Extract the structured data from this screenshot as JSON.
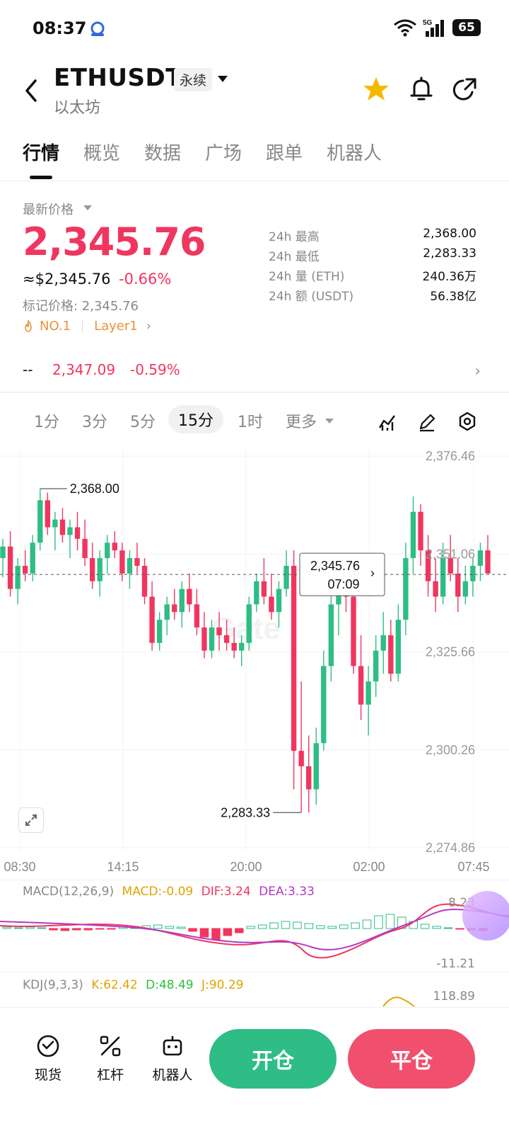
{
  "status_bar": {
    "time": "08:37",
    "network": "5G",
    "battery": "65"
  },
  "header": {
    "pair": "ETHUSDT",
    "contract_type": "永续",
    "subtitle": "以太坊"
  },
  "tabs": [
    "行情",
    "概览",
    "数据",
    "广场",
    "跟单",
    "机器人"
  ],
  "price": {
    "latest_label": "最新价格",
    "last_price": "2,345.76",
    "usd_price": "≈$2,345.76",
    "change_pct": "-0.66%",
    "mark_price": "标记价格: 2,345.76",
    "rank_tag": "NO.1",
    "sector_tag": "Layer1",
    "stats": [
      {
        "label": "24h  最高",
        "value": "2,368.00"
      },
      {
        "label": "24h  最低",
        "value": "2,283.33"
      },
      {
        "label": "24h  量 (ETH)",
        "value": "240.36万"
      },
      {
        "label": "24h  额 (USDT)",
        "value": "56.38亿"
      }
    ],
    "index_dash": "--",
    "index_price": "2,347.09",
    "index_change": "-0.59%"
  },
  "intervals": [
    "1分",
    "3分",
    "5分",
    "15分",
    "1时",
    "更多"
  ],
  "active_interval": "15分",
  "chart_data": {
    "type": "candlestick",
    "y_ticks": [
      "2,376.46",
      "2,351.06",
      "2,325.66",
      "2,300.26",
      "2,274.86"
    ],
    "y_range": [
      2274.86,
      2376.46
    ],
    "x_ticks": [
      "08:30",
      "14:15",
      "20:00",
      "02:00",
      "07:45"
    ],
    "high_label": "2,368.00",
    "low_label": "2,283.33",
    "current_price_label": "2,345.76",
    "countdown_label": "07:09",
    "ohlc": [
      [
        2350,
        2355,
        2345,
        2353
      ],
      [
        2353,
        2357,
        2340,
        2342
      ],
      [
        2342,
        2350,
        2338,
        2348
      ],
      [
        2348,
        2352,
        2344,
        2346
      ],
      [
        2346,
        2356,
        2344,
        2354
      ],
      [
        2354,
        2368,
        2352,
        2365
      ],
      [
        2365,
        2367,
        2356,
        2358
      ],
      [
        2358,
        2362,
        2352,
        2360
      ],
      [
        2360,
        2363,
        2354,
        2356
      ],
      [
        2356,
        2360,
        2350,
        2358
      ],
      [
        2358,
        2362,
        2352,
        2355
      ],
      [
        2355,
        2360,
        2348,
        2350
      ],
      [
        2350,
        2354,
        2342,
        2344
      ],
      [
        2344,
        2352,
        2340,
        2350
      ],
      [
        2350,
        2356,
        2346,
        2354
      ],
      [
        2354,
        2357,
        2350,
        2352
      ],
      [
        2352,
        2354,
        2344,
        2346
      ],
      [
        2346,
        2352,
        2342,
        2350
      ],
      [
        2350,
        2354,
        2346,
        2348
      ],
      [
        2348,
        2350,
        2338,
        2340
      ],
      [
        2340,
        2344,
        2326,
        2328
      ],
      [
        2328,
        2336,
        2326,
        2334
      ],
      [
        2334,
        2340,
        2330,
        2338
      ],
      [
        2338,
        2342,
        2334,
        2336
      ],
      [
        2336,
        2344,
        2332,
        2342
      ],
      [
        2342,
        2346,
        2336,
        2338
      ],
      [
        2338,
        2342,
        2330,
        2332
      ],
      [
        2332,
        2336,
        2324,
        2326
      ],
      [
        2326,
        2334,
        2324,
        2332
      ],
      [
        2332,
        2336,
        2326,
        2330
      ],
      [
        2330,
        2334,
        2326,
        2328
      ],
      [
        2328,
        2332,
        2324,
        2326
      ],
      [
        2326,
        2330,
        2322,
        2328
      ],
      [
        2328,
        2340,
        2326,
        2338
      ],
      [
        2338,
        2346,
        2336,
        2344
      ],
      [
        2344,
        2350,
        2338,
        2340
      ],
      [
        2340,
        2346,
        2334,
        2336
      ],
      [
        2336,
        2344,
        2332,
        2342
      ],
      [
        2342,
        2352,
        2340,
        2348
      ],
      [
        2348,
        2352,
        2290,
        2300
      ],
      [
        2300,
        2318,
        2284,
        2296
      ],
      [
        2296,
        2304,
        2284,
        2290
      ],
      [
        2290,
        2306,
        2286,
        2302
      ],
      [
        2302,
        2326,
        2300,
        2322
      ],
      [
        2322,
        2342,
        2318,
        2338
      ],
      [
        2338,
        2346,
        2330,
        2344
      ],
      [
        2344,
        2348,
        2336,
        2340
      ],
      [
        2340,
        2344,
        2320,
        2322
      ],
      [
        2322,
        2330,
        2308,
        2312
      ],
      [
        2312,
        2322,
        2304,
        2318
      ],
      [
        2318,
        2330,
        2314,
        2326
      ],
      [
        2326,
        2336,
        2320,
        2330
      ],
      [
        2330,
        2334,
        2318,
        2320
      ],
      [
        2320,
        2338,
        2318,
        2334
      ],
      [
        2334,
        2354,
        2330,
        2350
      ],
      [
        2350,
        2366,
        2346,
        2362
      ],
      [
        2362,
        2364,
        2348,
        2352
      ],
      [
        2352,
        2356,
        2340,
        2344
      ],
      [
        2344,
        2350,
        2336,
        2340
      ],
      [
        2340,
        2354,
        2338,
        2350
      ],
      [
        2350,
        2356,
        2344,
        2346
      ],
      [
        2346,
        2350,
        2336,
        2340
      ],
      [
        2340,
        2348,
        2338,
        2344
      ],
      [
        2344,
        2350,
        2340,
        2348
      ],
      [
        2348,
        2354,
        2344,
        2352
      ],
      [
        2352,
        2356,
        2346,
        2346
      ]
    ]
  },
  "macd": {
    "label": "MACD(12,26,9)",
    "macd": "MACD:-0.09",
    "dif": "DIF:3.24",
    "dea": "DEA:3.33",
    "y_top": "8.23",
    "y_bottom": "-11.21"
  },
  "kdj": {
    "label": "KDJ(9,3,3)",
    "k": "K:62.42",
    "d": "D:48.49",
    "j": "J:90.29",
    "y_top": "118.89"
  },
  "bottom_nav": [
    "现货",
    "杠杆",
    "机器人"
  ],
  "actions": {
    "open": "开仓",
    "close": "平仓"
  },
  "colors": {
    "up": "#2ebd85",
    "down": "#f0365f",
    "macd_dif": "#f0365f",
    "macd_dea": "#b23bc4"
  }
}
